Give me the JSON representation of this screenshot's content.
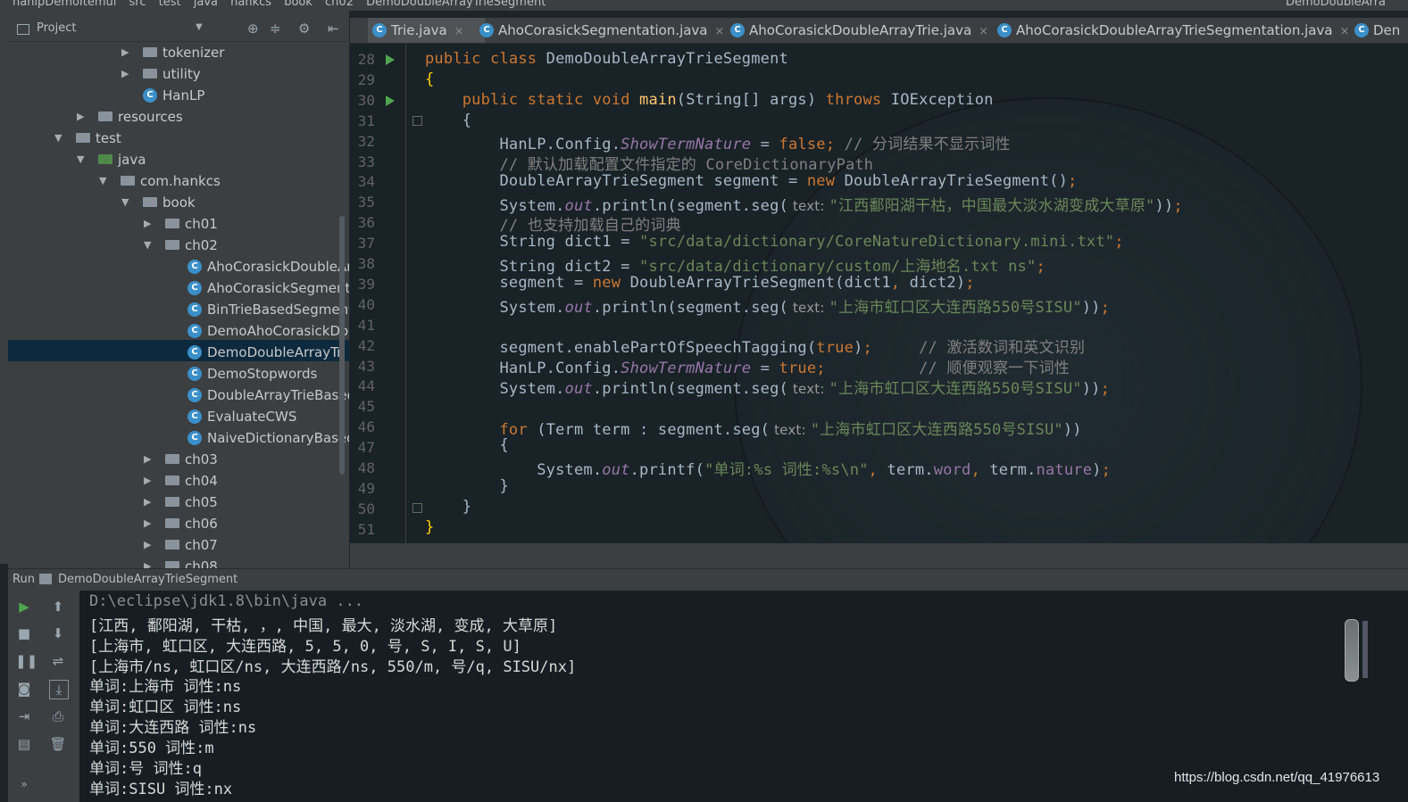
{
  "breadcrumbs": {
    "items": [
      "hanlpDemoItemui",
      "src",
      "test",
      "java",
      "hankcs",
      "book",
      "ch02",
      "DemoDoubleArrayTrieSegment"
    ],
    "right": "DemoDoubleArra"
  },
  "project_panel": {
    "title": "Project",
    "tree": [
      {
        "label": "tokenizer",
        "kind": "folder",
        "arrow": "▶"
      },
      {
        "label": "utility",
        "kind": "folder",
        "arrow": "▶"
      },
      {
        "label": "HanLP",
        "kind": "class",
        "arrow": ""
      },
      {
        "label": "resources",
        "kind": "folder",
        "arrow": "▶"
      },
      {
        "label": "test",
        "kind": "folder",
        "arrow": "▼"
      },
      {
        "label": "java",
        "kind": "srcfolder",
        "arrow": "▼"
      },
      {
        "label": "com.hankcs",
        "kind": "folder",
        "arrow": "▼"
      },
      {
        "label": "book",
        "kind": "folder",
        "arrow": "▼"
      },
      {
        "label": "ch01",
        "kind": "folder",
        "arrow": "▶"
      },
      {
        "label": "ch02",
        "kind": "folder",
        "arrow": "▼"
      },
      {
        "label": "AhoCorasickDoubleAr",
        "kind": "class",
        "arrow": ""
      },
      {
        "label": "AhoCorasickSegment",
        "kind": "class",
        "arrow": ""
      },
      {
        "label": "BinTrieBasedSegment",
        "kind": "class",
        "arrow": ""
      },
      {
        "label": "DemoAhoCorasickDo",
        "kind": "class",
        "arrow": ""
      },
      {
        "label": "DemoDoubleArrayTri",
        "kind": "class",
        "arrow": ""
      },
      {
        "label": "DemoStopwords",
        "kind": "class",
        "arrow": ""
      },
      {
        "label": "DoubleArrayTrieBased",
        "kind": "class",
        "arrow": ""
      },
      {
        "label": "EvaluateCWS",
        "kind": "class",
        "arrow": ""
      },
      {
        "label": "NaiveDictionaryBased",
        "kind": "class",
        "arrow": ""
      },
      {
        "label": "ch03",
        "kind": "folder",
        "arrow": "▶"
      },
      {
        "label": "ch04",
        "kind": "folder",
        "arrow": "▶"
      },
      {
        "label": "ch05",
        "kind": "folder",
        "arrow": "▶"
      },
      {
        "label": "ch06",
        "kind": "folder",
        "arrow": "▶"
      },
      {
        "label": "ch07",
        "kind": "folder",
        "arrow": "▶"
      },
      {
        "label": "ch08",
        "kind": "folder",
        "arrow": "▶"
      }
    ],
    "selected": "DemoDoubleArrayTri"
  },
  "tabs": [
    {
      "label": "Trie.java",
      "active": true
    },
    {
      "label": "AhoCorasickSegmentation.java",
      "active": false
    },
    {
      "label": "AhoCorasickDoubleArrayTrie.java",
      "active": false
    },
    {
      "label": "AhoCorasickDoubleArrayTrieSegmentation.java",
      "active": false
    },
    {
      "label": "Den",
      "active": false
    }
  ],
  "editor": {
    "line_numbers": [
      "28",
      "29",
      "30",
      "31",
      "32",
      "33",
      "34",
      "35",
      "36",
      "37",
      "38",
      "39",
      "40",
      "41",
      "42",
      "43",
      "44",
      "45",
      "46",
      "47",
      "48",
      "49",
      "50",
      "51"
    ],
    "code": {
      "l28_a": "public class ",
      "l28_b": "DemoDoubleArrayTrieSegment",
      "l29": "{",
      "l30_a": "    public static void ",
      "l30_b": "main",
      "l30_c": "(String[] args) ",
      "l30_d": "throws ",
      "l30_e": "IOException",
      "l31": "    {",
      "l32_a": "        HanLP.Config.",
      "l32_b": "ShowTermNature",
      "l32_c": " = ",
      "l32_d": "false",
      "l32_e": "; ",
      "l32_f": "// 分词结果不显示词性",
      "l33": "        // 默认加载配置文件指定的 CoreDictionaryPath",
      "l34_a": "        DoubleArrayTrieSegment segment = ",
      "l34_b": "new ",
      "l34_c": "DoubleArrayTrieSegment()",
      "l34_d": ";",
      "l35_a": "        System.",
      "l35_b": "out",
      "l35_c": ".println(segment.seg(",
      "l35_hint": " text: ",
      "l35_d": "\"江西鄱阳湖干枯，中国最大淡水湖变成大草原\"",
      "l35_e": "))",
      "l35_f": ";",
      "l36": "        // 也支持加载自己的词典",
      "l37_a": "        String dict1 = ",
      "l37_b": "\"src/data/dictionary/CoreNatureDictionary.mini.txt\"",
      "l37_c": ";",
      "l38_a": "        String dict2 = ",
      "l38_b": "\"src/data/dictionary/custom/上海地名.txt ns\"",
      "l38_c": ";",
      "l39_a": "        segment = ",
      "l39_b": "new ",
      "l39_c": "DoubleArrayTrieSegment(dict1",
      "l39_d": ", ",
      "l39_e": "dict2)",
      "l39_f": ";",
      "l40_a": "        System.",
      "l40_b": "out",
      "l40_c": ".println(segment.seg(",
      "l40_hint": " text: ",
      "l40_d": "\"上海市虹口区大连西路550号SISU\"",
      "l40_e": "))",
      "l40_f": ";",
      "l41": "",
      "l42_a": "        segment.enablePartOfSpeechTagging(",
      "l42_b": "true",
      "l42_c": ")",
      "l42_d": ";",
      "l42_e": "     // 激活数词和英文识别",
      "l43_a": "        HanLP.Config.",
      "l43_b": "ShowTermNature",
      "l43_c": " = ",
      "l43_d": "true",
      "l43_e": ";",
      "l43_f": "          // 顺便观察一下词性",
      "l44_a": "        System.",
      "l44_b": "out",
      "l44_c": ".println(segment.seg(",
      "l44_hint": " text: ",
      "l44_d": "\"上海市虹口区大连西路550号SISU\"",
      "l44_e": "))",
      "l44_f": ";",
      "l45": "",
      "l46_a": "        ",
      "l46_b": "for ",
      "l46_c": "(Term term : segment.seg(",
      "l46_hint": " text: ",
      "l46_d": "\"上海市虹口区大连西路550号SISU\"",
      "l46_e": "))",
      "l47": "        {",
      "l48_a": "            System.",
      "l48_b": "out",
      "l48_c": ".printf(",
      "l48_d": "\"单词:%s 词性:%s\\n\"",
      "l48_e": ", ",
      "l48_f": "term.",
      "l48_g": "word",
      "l48_h": ", ",
      "l48_i": "term.",
      "l48_j": "nature",
      "l48_k": ")",
      "l48_l": ";",
      "l49": "        }",
      "l50": "    }",
      "l51": "}"
    }
  },
  "run_panel": {
    "label": "Run",
    "config_name": "DemoDoubleArrayTrieSegment",
    "console": [
      "D:\\eclipse\\jdk1.8\\bin\\java ...",
      "[江西, 鄱阳湖, 干枯, ，, 中国, 最大, 淡水湖, 变成, 大草原]",
      "[上海市, 虹口区, 大连西路, 5, 5, 0, 号, S, I, S, U]",
      "[上海市/ns, 虹口区/ns, 大连西路/ns, 550/m, 号/q, SISU/nx]",
      "单词:上海市 词性:ns",
      "单词:虹口区 词性:ns",
      "单词:大连西路 词性:ns",
      "单词:550 词性:m",
      "单词:号 词性:q",
      "单词:SISU 词性:nx"
    ]
  },
  "watermark": "https://blog.csdn.net/qq_41976613",
  "colors": {
    "keyword": "#cc7832",
    "string": "#6a8759",
    "field": "#9876aa",
    "comment": "#808080",
    "brace": "#ffd000",
    "selection": "#0d293e"
  }
}
